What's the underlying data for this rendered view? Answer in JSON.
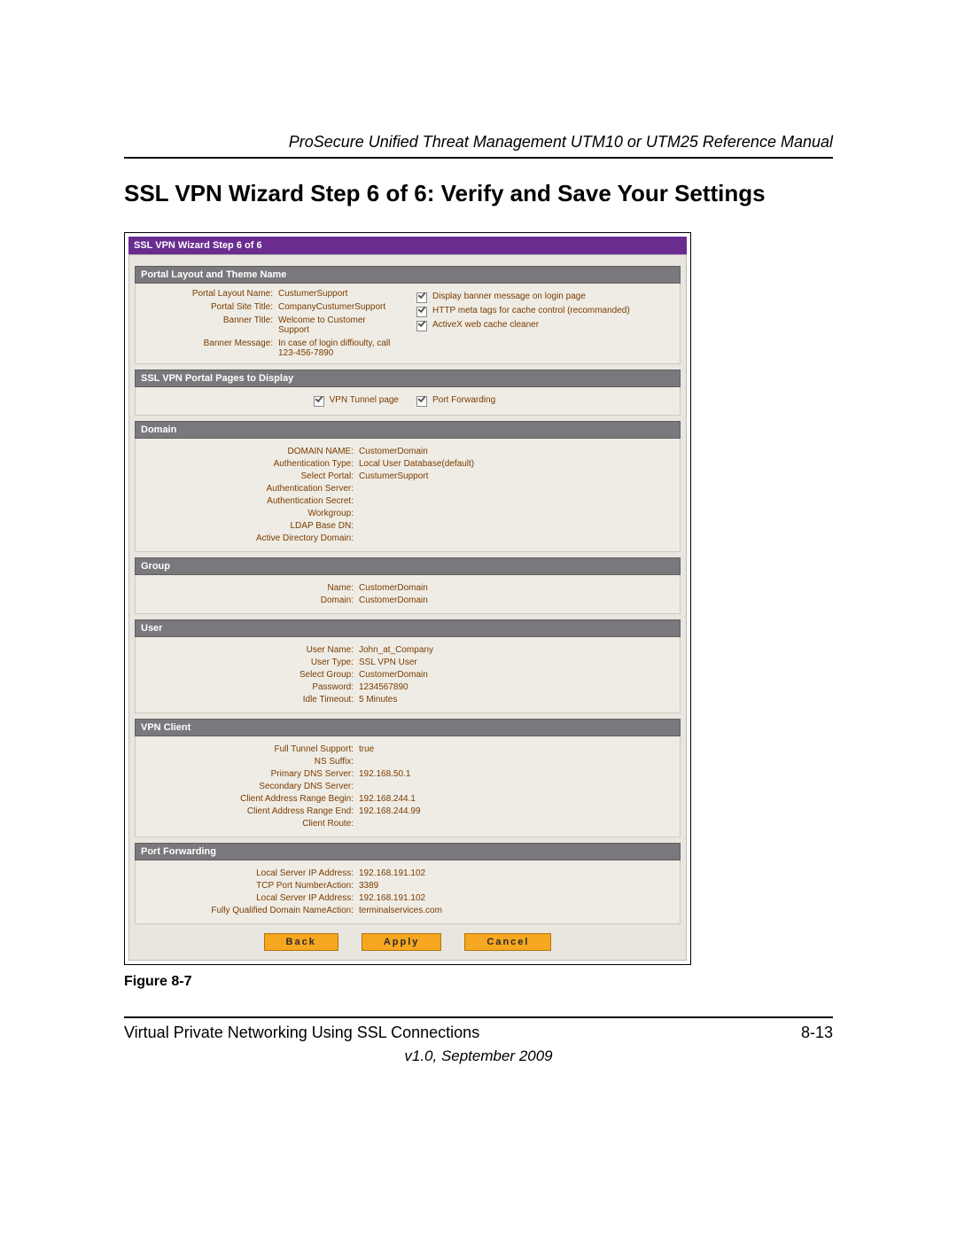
{
  "doc_header": "ProSecure Unified Threat Management UTM10 or UTM25 Reference Manual",
  "page_title": "SSL VPN Wizard Step 6 of 6: Verify and Save Your Settings",
  "wizard_title": "SSL VPN Wizard Step 6 of 6",
  "sections": {
    "portal_layout": {
      "head": "Portal Layout and Theme Name",
      "left": [
        {
          "k": "Portal Layout Name:",
          "v": "CustumerSupport"
        },
        {
          "k": "Portal Site Title:",
          "v": "CompanyCustumerSupport"
        },
        {
          "k": "Banner Title:",
          "v": "Welcome to Customer Support"
        },
        {
          "k": "Banner Message:",
          "v": "In case of login diffioulty, call 123-456-7890"
        }
      ],
      "right": [
        {
          "checked": true,
          "label": "Display banner message on login page"
        },
        {
          "checked": true,
          "label": "HTTP meta tags for cache control (recommanded)"
        },
        {
          "checked": true,
          "label": "ActiveX web cache cleaner"
        }
      ]
    },
    "pages_display": {
      "head": "SSL VPN Portal Pages to Display",
      "items": [
        {
          "checked": true,
          "label": "VPN Tunnel page"
        },
        {
          "checked": true,
          "label": "Port Forwarding"
        }
      ]
    },
    "domain": {
      "head": "Domain",
      "rows": [
        {
          "k": "DOMAIN NAME:",
          "v": "CustomerDomain"
        },
        {
          "k": "Authentication Type:",
          "v": "Local User Database(default)"
        },
        {
          "k": "Select Portal:",
          "v": "CustumerSupport"
        },
        {
          "k": "Authentication Server:",
          "v": ""
        },
        {
          "k": "Authentication Secret:",
          "v": ""
        },
        {
          "k": "Workgroup:",
          "v": ""
        },
        {
          "k": "LDAP Base DN:",
          "v": ""
        },
        {
          "k": "Active Directory Domain:",
          "v": ""
        }
      ]
    },
    "group": {
      "head": "Group",
      "rows": [
        {
          "k": "Name:",
          "v": "CustomerDomain"
        },
        {
          "k": "Domain:",
          "v": "CustomerDomain"
        }
      ]
    },
    "user": {
      "head": "User",
      "rows": [
        {
          "k": "User Name:",
          "v": "John_at_Company"
        },
        {
          "k": "User Type:",
          "v": "SSL VPN User"
        },
        {
          "k": "Select Group:",
          "v": "CustomerDomain"
        },
        {
          "k": "Password:",
          "v": "1234567890"
        },
        {
          "k": "Idle Timeout:",
          "v": "5 Minutes"
        }
      ]
    },
    "vpn_client": {
      "head": "VPN Client",
      "rows": [
        {
          "k": "Full Tunnel Support:",
          "v": "true"
        },
        {
          "k": "NS Suffix:",
          "v": ""
        },
        {
          "k": "Primary DNS Server:",
          "v": "192.168.50.1"
        },
        {
          "k": "Secondary DNS Server:",
          "v": ""
        },
        {
          "k": "Client Address Range Begin:",
          "v": "192.168.244.1"
        },
        {
          "k": "Client Address Range End:",
          "v": "192.168.244.99"
        },
        {
          "k": "Client Route:",
          "v": ""
        }
      ]
    },
    "port_forwarding": {
      "head": "Port Forwarding",
      "rows": [
        {
          "k": "Local Server IP Address:",
          "v": "192.168.191.102"
        },
        {
          "k": "TCP Port NumberAction:",
          "v": "3389"
        },
        {
          "k": "Local Server IP Address:",
          "v": "192.168.191.102"
        },
        {
          "k": "Fully Qualified Domain NameAction:",
          "v": "terminalservices.com"
        }
      ]
    }
  },
  "buttons": {
    "back": "Back",
    "apply": "Apply",
    "cancel": "Cancel"
  },
  "figure_caption": "Figure 8-7",
  "footer_left": "Virtual Private Networking Using SSL Connections",
  "footer_right": "8-13",
  "footer_version": "v1.0, September 2009"
}
